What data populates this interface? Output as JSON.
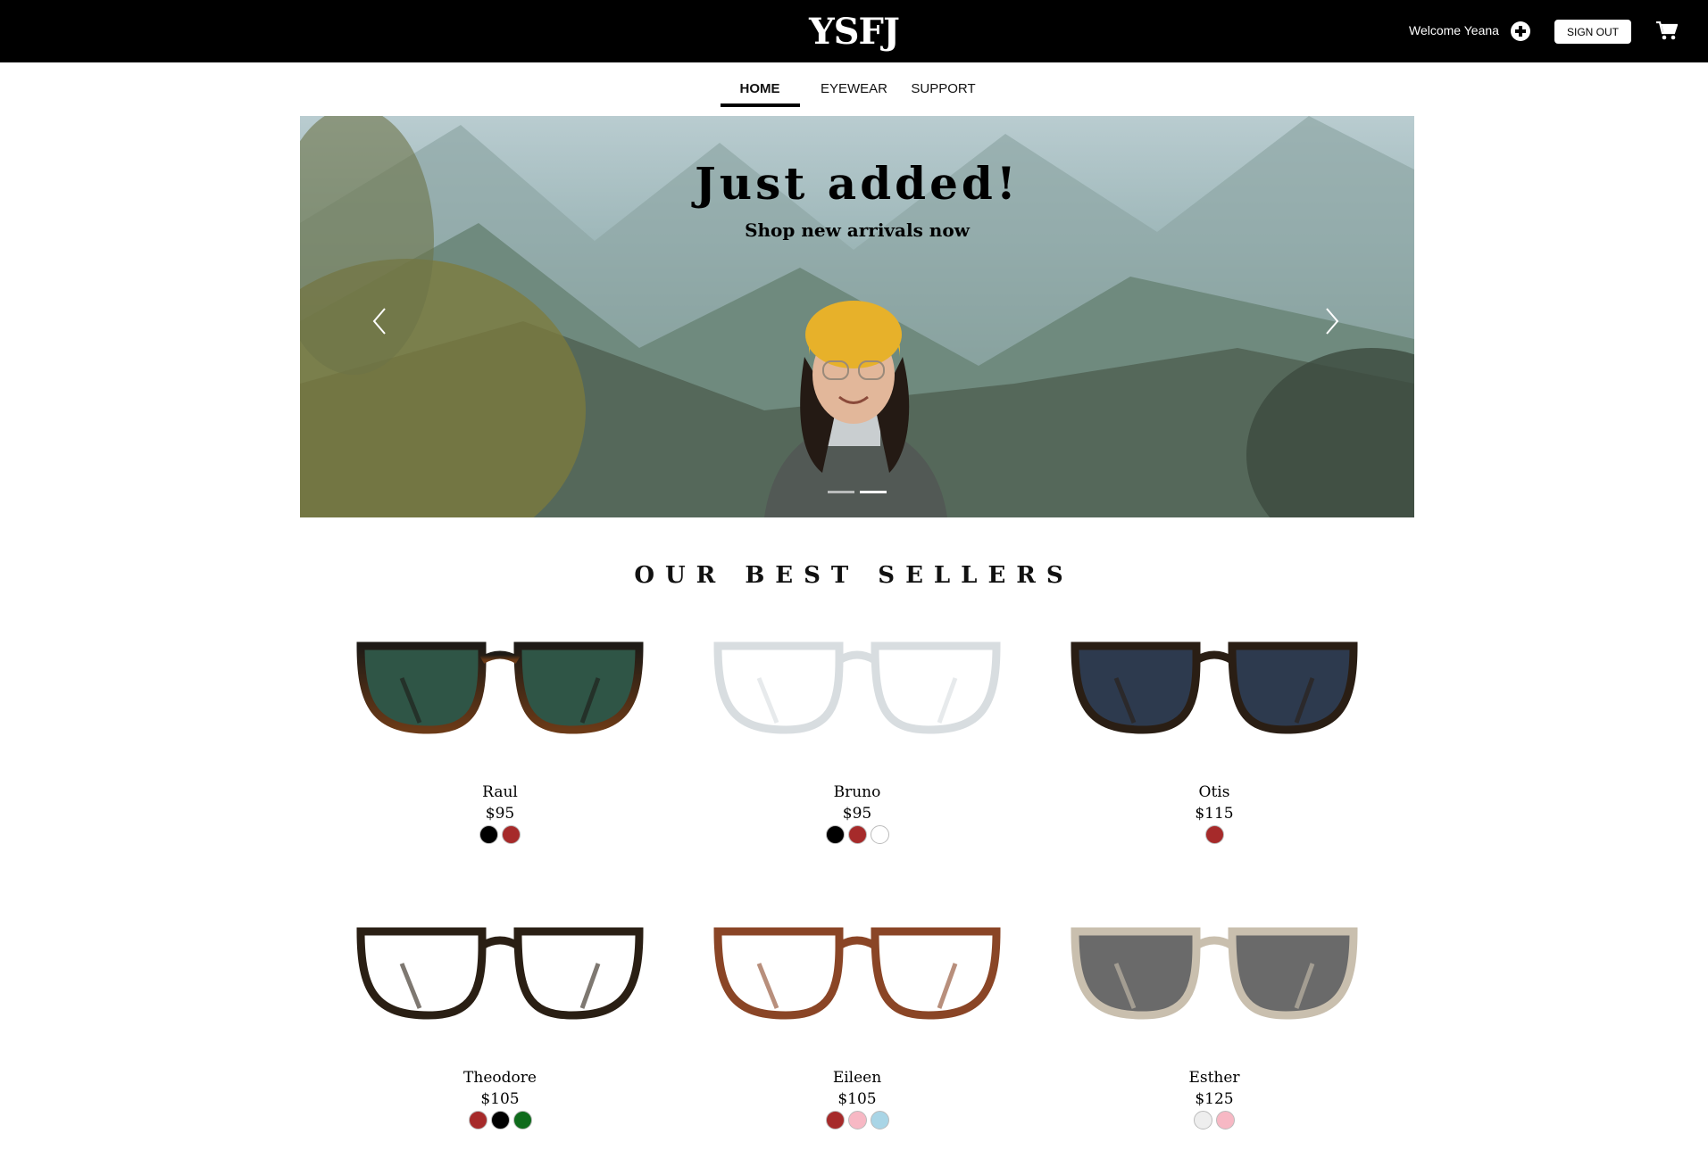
{
  "header": {
    "logo": "YSFJ",
    "welcome": "Welcome Yeana",
    "sign_out": "SIGN OUT"
  },
  "nav": {
    "items": [
      "HOME",
      "EYEWEAR",
      "SUPPORT"
    ],
    "active": "HOME"
  },
  "hero": {
    "title": "Just added!",
    "subtitle": "Shop new arrivals now",
    "slides": 2,
    "active_slide": 2
  },
  "best_sellers": {
    "title": "OUR BEST SELLERS",
    "products": [
      {
        "name": "Raul",
        "price": "$95",
        "colors": [
          "#000000",
          "#a62a2a"
        ],
        "lens": "#2f5546",
        "frame": "#1e1a16",
        "frame_bottom": "#6b3a17"
      },
      {
        "name": "Bruno",
        "price": "$95",
        "colors": [
          "#000000",
          "#a62a2a",
          "#ffffff"
        ],
        "lens": "#ffffff",
        "frame": "#d8dde0",
        "frame_bottom": "#d8dde0"
      },
      {
        "name": "Otis",
        "price": "$115",
        "colors": [
          "#a62a2a"
        ],
        "lens": "#2d3a4e",
        "frame": "#2a1e14",
        "frame_bottom": "#2a1e14"
      },
      {
        "name": "Theodore",
        "price": "$105",
        "colors": [
          "#a62a2a",
          "#000000",
          "#0f6b1c"
        ],
        "lens": "#ffffff",
        "frame": "#2a1f14",
        "frame_bottom": "#2a1f14"
      },
      {
        "name": "Eileen",
        "price": "$105",
        "colors": [
          "#a62a2a",
          "#f7b8c4",
          "#a9d5e6"
        ],
        "lens": "#ffffff",
        "frame": "#8a4526",
        "frame_bottom": "#8a4526"
      },
      {
        "name": "Esther",
        "price": "$125",
        "colors": [
          "#eeeeee",
          "#f7b8c4"
        ],
        "lens": "#6a6a6a",
        "frame": "#c9bfae",
        "frame_bottom": "#c9bfae"
      }
    ]
  }
}
